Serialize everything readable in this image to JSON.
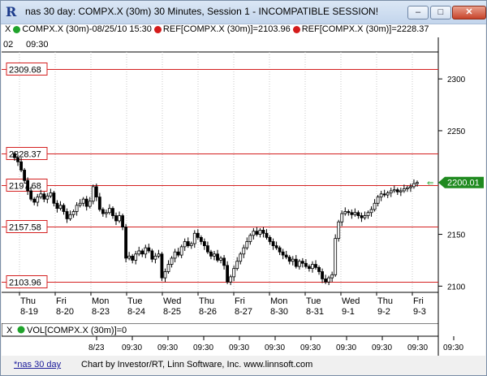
{
  "window": {
    "title": "nas 30 day:  COMPX.X (30m) 30 Minutes, Session 1 - INCOMPATIBLE SESSION!",
    "buttons": {
      "minimize": "–",
      "maximize": "□",
      "close": "✕"
    }
  },
  "legend": {
    "x_label": "X",
    "series": "COMPX.X (30m)-08/25/10 15:30",
    "ref1": "REF[COMPX.X (30m)]=2103.96",
    "ref2": "REF[COMPX.X (30m)]=2228.37"
  },
  "top_time": {
    "left": "02",
    "time": "09:30"
  },
  "levels": [
    {
      "label": "2309.68",
      "value": 2309.68
    },
    {
      "label": "2228.37",
      "value": 2228.37
    },
    {
      "label": "2197.68",
      "value": 2197.68
    },
    {
      "label": "2157.58",
      "value": 2157.58
    },
    {
      "label": "2103.96",
      "value": 2103.96
    }
  ],
  "y_axis": {
    "ticks": [
      "2300",
      "2250",
      "2200",
      "2150",
      "2100"
    ],
    "current": "2200.01",
    "current_value": 2200.01,
    "min": 2094,
    "max": 2326
  },
  "days": [
    {
      "dow": "Thu",
      "date": "8-19"
    },
    {
      "dow": "Fri",
      "date": "8-20"
    },
    {
      "dow": "Mon",
      "date": "8-23"
    },
    {
      "dow": "Tue",
      "date": "8-24"
    },
    {
      "dow": "Wed",
      "date": "8-25"
    },
    {
      "dow": "Thu",
      "date": "8-26"
    },
    {
      "dow": "Fri",
      "date": "8-27"
    },
    {
      "dow": "Mon",
      "date": "8-30"
    },
    {
      "dow": "Tue",
      "date": "8-31"
    },
    {
      "dow": "Wed",
      "date": "9-1"
    },
    {
      "dow": "Thu",
      "date": "9-2"
    },
    {
      "dow": "Fri",
      "date": "9-3"
    }
  ],
  "volume": {
    "label": "VOL[COMPX.X (30m)]=0",
    "time_labels": [
      "8/23",
      "09:30",
      "09:30",
      "09:30",
      "09:30",
      "09:30",
      "09:30",
      "09:30",
      "09:30",
      "09:30",
      "09:30"
    ]
  },
  "chart_data": {
    "type": "candlestick",
    "title": "COMPX.X (30m)-08/25/10 15:30",
    "ylim": [
      2094,
      2326
    ],
    "reference_lines": [
      2309.68,
      2228.37,
      2197.68,
      2157.58,
      2103.96
    ],
    "closes": [
      2224,
      2220,
      2212,
      2202,
      2192,
      2184,
      2181,
      2186,
      2189,
      2184,
      2187,
      2190,
      2180,
      2175,
      2178,
      2172,
      2165,
      2169,
      2172,
      2178,
      2180,
      2184,
      2177,
      2182,
      2196,
      2186,
      2174,
      2170,
      2171,
      2175,
      2168,
      2163,
      2168,
      2157,
      2127,
      2129,
      2125,
      2131,
      2134,
      2131,
      2137,
      2134,
      2126,
      2129,
      2131,
      2108,
      2114,
      2121,
      2127,
      2133,
      2130,
      2138,
      2143,
      2139,
      2141,
      2151,
      2147,
      2143,
      2139,
      2133,
      2129,
      2131,
      2125,
      2127,
      2120,
      2104,
      2109,
      2117,
      2124,
      2131,
      2137,
      2143,
      2149,
      2153,
      2150,
      2154,
      2151,
      2147,
      2143,
      2139,
      2137,
      2133,
      2130,
      2128,
      2124,
      2126,
      2119,
      2124,
      2122,
      2119,
      2117,
      2121,
      2118,
      2114,
      2107,
      2104,
      2108,
      2111,
      2146,
      2162,
      2170,
      2172,
      2171,
      2169,
      2171,
      2168,
      2166,
      2168,
      2171,
      2174,
      2180,
      2186,
      2189,
      2188,
      2190,
      2192,
      2193,
      2191,
      2192,
      2194,
      2195,
      2196,
      2199,
      2200
    ]
  },
  "status": {
    "tab": "*nas 30 day",
    "credit": "Chart by Investor/RT, Linn Software, Inc. www.linnsoft.com"
  }
}
